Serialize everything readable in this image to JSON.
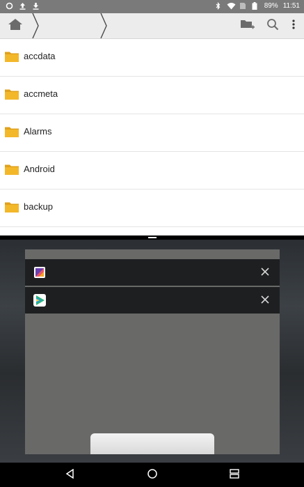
{
  "status_bar": {
    "battery_text": "89%",
    "time": "11:51",
    "left_icons": [
      "sync-icon",
      "upload-icon",
      "download-icon"
    ],
    "right_icons": [
      "bluetooth-icon",
      "wifi-icon",
      "sim-icon",
      "battery-icon"
    ]
  },
  "toolbar": {
    "icons": [
      "home-icon",
      "new-folder-icon",
      "search-icon",
      "overflow-menu-icon"
    ]
  },
  "files": [
    {
      "name": "accdata"
    },
    {
      "name": "accmeta"
    },
    {
      "name": "Alarms"
    },
    {
      "name": "Android"
    },
    {
      "name": "backup"
    }
  ],
  "recents": {
    "cards": [
      {
        "icon": "gallery-app-icon",
        "close_icon": "close-icon"
      },
      {
        "icon": "video-player-app-icon",
        "close_icon": "close-icon"
      }
    ]
  },
  "navigation": {
    "icons": [
      "back-icon",
      "home-circle-icon",
      "recents-icon"
    ]
  },
  "colors": {
    "status_bar": "#7a7a7a",
    "toolbar": "#ececec",
    "folder": "#f3b72a",
    "recents_card": "#696a68",
    "card_header": "#1e1f20"
  }
}
